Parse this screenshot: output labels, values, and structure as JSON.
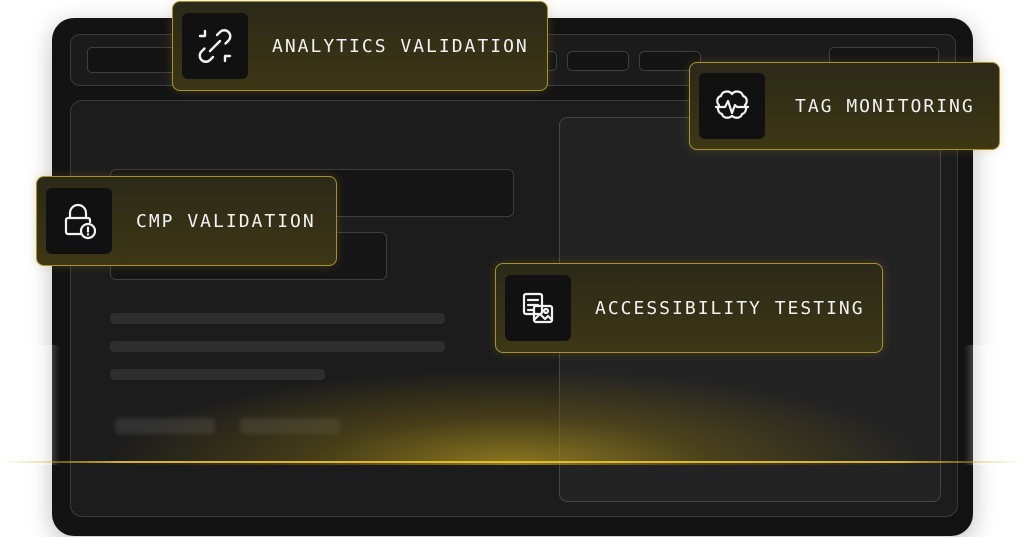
{
  "cards": {
    "analytics": {
      "label": "ANALYTICS VALIDATION",
      "icon": "broken-link-icon"
    },
    "tag": {
      "label": "TAG MONITORING",
      "icon": "brain-pulse-icon"
    },
    "cmp": {
      "label": "CMP VALIDATION",
      "icon": "lock-warning-icon"
    },
    "accessibility": {
      "label": "ACCESSIBILITY TESTING",
      "icon": "image-caption-icon"
    }
  },
  "colors": {
    "accent": "#d6b22e",
    "card_border": "#a8922c",
    "browser_bg": "#131313",
    "label_text": "#f2f2f2"
  }
}
